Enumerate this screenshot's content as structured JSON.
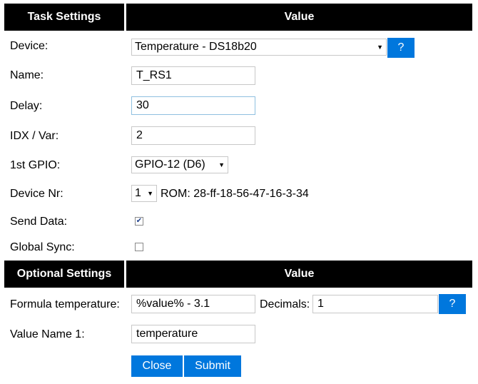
{
  "headers": {
    "task_settings": "Task Settings",
    "value": "Value",
    "optional_settings": "Optional Settings",
    "value2": "Value"
  },
  "fields": {
    "device": {
      "label": "Device:",
      "selected": "Temperature - DS18b20",
      "help": "?"
    },
    "name": {
      "label": "Name:",
      "value": "T_RS1"
    },
    "delay": {
      "label": "Delay:",
      "value": "30"
    },
    "idx": {
      "label": "IDX / Var:",
      "value": "2"
    },
    "gpio": {
      "label": "1st GPIO:",
      "selected": "GPIO-12 (D6)"
    },
    "device_nr": {
      "label": "Device Nr:",
      "selected": "1",
      "rom": "ROM: 28-ff-18-56-47-16-3-34"
    },
    "send_data": {
      "label": "Send Data:",
      "checked": true
    },
    "global_sync": {
      "label": "Global Sync:",
      "checked": false
    }
  },
  "optional": {
    "formula": {
      "label": "Formula temperature:",
      "value": "%value% - 3.1"
    },
    "decimals": {
      "label": "Decimals:",
      "value": "1",
      "help": "?"
    },
    "value_name": {
      "label": "Value Name 1:",
      "value": "temperature"
    }
  },
  "buttons": {
    "close": "Close",
    "submit": "Submit"
  },
  "colors": {
    "header_bg": "#000000",
    "button_bg": "#0077dd",
    "check_color": "#1e3f8a"
  },
  "icons": {
    "select_caret": "caret-down-icon",
    "checkmark": "checkmark-icon"
  }
}
